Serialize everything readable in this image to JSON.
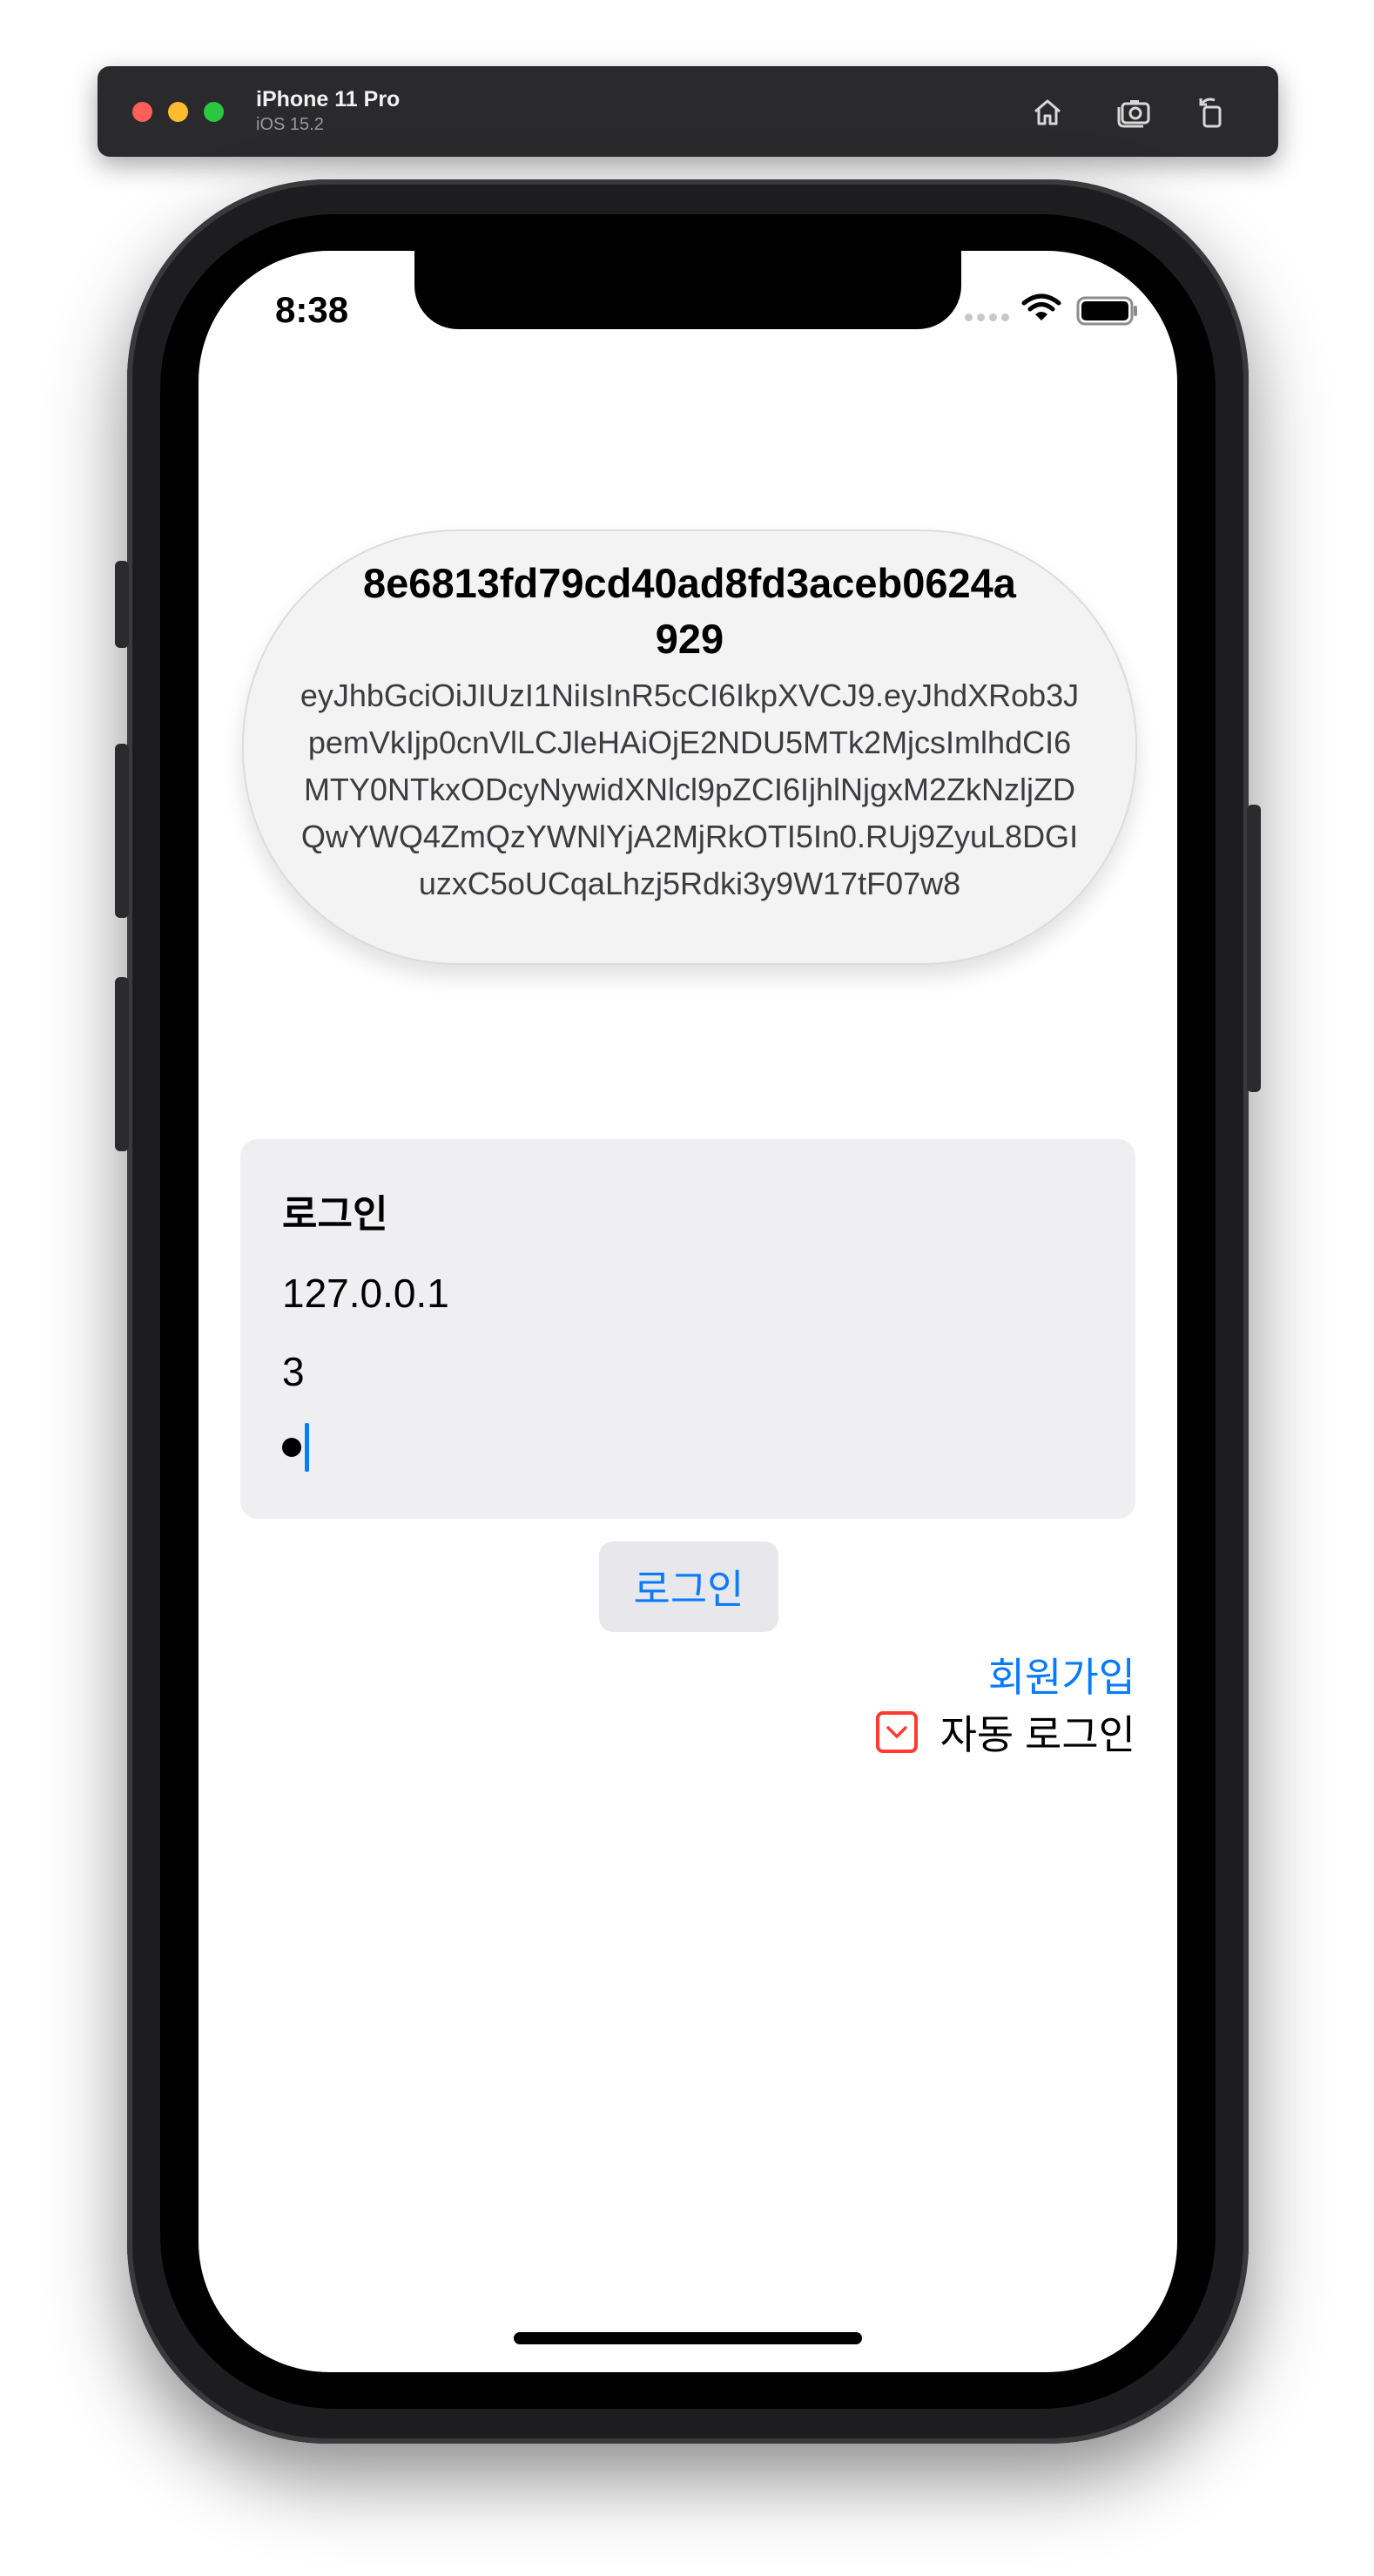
{
  "simulator": {
    "device_name": "iPhone 11 Pro",
    "os_version": "iOS 15.2",
    "icons": [
      "home-icon",
      "screenshot-icon",
      "rotate-icon"
    ]
  },
  "status_bar": {
    "time": "8:38",
    "icons": [
      "signal-icon",
      "wifi-icon",
      "battery-icon"
    ]
  },
  "token": {
    "session_id_line1": "8e6813fd79cd40ad8fd3aceb0624a",
    "session_id_line2": "929",
    "jwt": "eyJhbGciOiJIUzI1NiIsInR5cCI6IkpXVCJ9.eyJhdXRob3JpemVkIjp0cnVlLCJleHAiOjE2NDU5MTk2MjcsImlhdCI6MTY0NTkxODcyNywidXNlcl9pZCI6IjhlNjgxM2ZkNzljZDQwYWQ4ZmQzYWNlYjA2MjRkOTI5In0.RUj9ZyuL8DGIuzxC5oUCqaLhzj5Rdki3y9W17tF07w8"
  },
  "login_form": {
    "title": "로그인",
    "host_value": "127.0.0.1",
    "user_value": "3"
  },
  "actions": {
    "login_label": "로그인",
    "signup_label": "회원가입",
    "auto_login_label": "자동 로그인",
    "auto_login_checked": true
  },
  "colors": {
    "accent": "#0a7aff",
    "checkbox": "#ff3b30",
    "card_bg": "#efeff2"
  }
}
